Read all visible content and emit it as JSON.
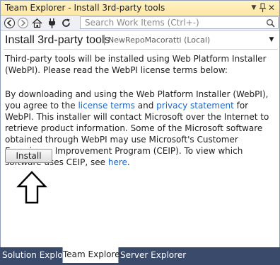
{
  "window": {
    "title": "Team Explorer - Install 3rd-party tools",
    "controls": {
      "dropdown_glyph": "▼",
      "close_glyph": "✕"
    }
  },
  "toolbar": {
    "buttons": [
      "back-icon",
      "forward-icon",
      "home-icon",
      "connect-icon",
      "refresh-icon"
    ],
    "search_placeholder": "Search Work Items (Ctrl+-)",
    "search_value": ""
  },
  "header": {
    "title": "Install 3rd-party tools",
    "context": "NewRepoMacoratti (Local)",
    "menu_glyph": "▼"
  },
  "content": {
    "para1": "Third-party tools will be installed using Web Platform Installer (WebPI). Please read the WebPI license terms below:",
    "para2_text1": "By downloading and using the Web Platform Installer (WebPI), you agree to the ",
    "license_link": "license terms",
    "para2_and": " and ",
    "privacy_link": "privacy statement",
    "para2_text2": " for WebPI. This installer will contact Microsoft over the Internet to retrieve product information. Some of the Microsoft software obtained through WebPI may use Microsoft's Customer Experience Improvement Program (CEIP). To view which software uses CEIP, see ",
    "here_link": "here",
    "para2_end": ".",
    "install_label": "Install"
  },
  "bottom_tabs": [
    {
      "label": "Solution Explorer",
      "active": false
    },
    {
      "label": "Team Explorer",
      "active": true
    },
    {
      "label": "Server Explorer",
      "active": false
    }
  ],
  "colors": {
    "title_bar": "#ffe7a3",
    "link": "#1e66c6",
    "bottom_bar": "#3a4a6b"
  }
}
